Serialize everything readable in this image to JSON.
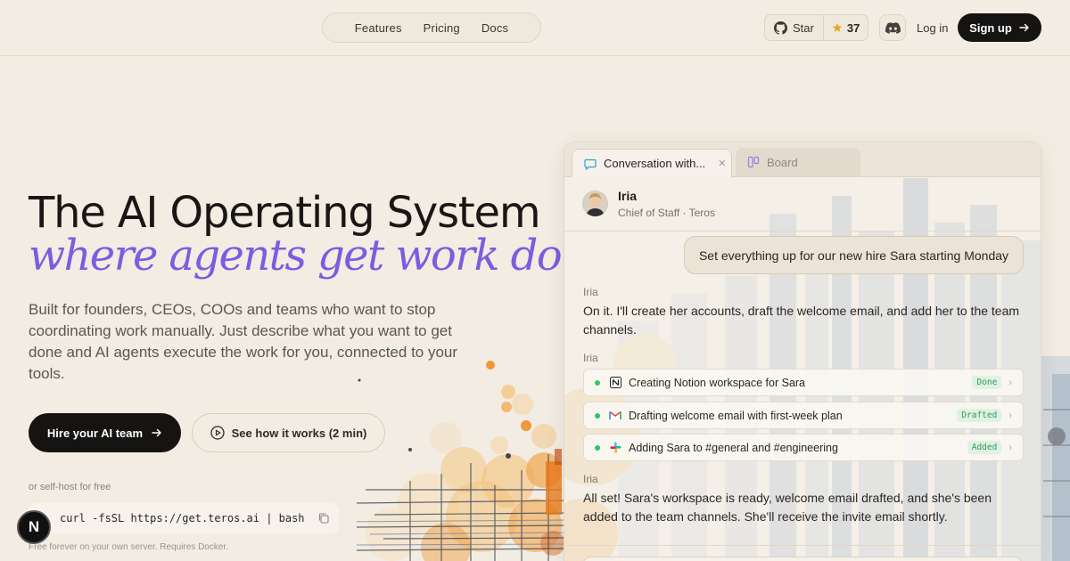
{
  "nav": {
    "links": [
      "Features",
      "Pricing",
      "Docs"
    ],
    "star_label": "Star",
    "star_count": "37",
    "login": "Log in",
    "signup": "Sign up"
  },
  "hero": {
    "title": "The AI Operating System",
    "subtitle": "where agents get work done.",
    "description": "Built for founders, CEOs, COOs and teams who want to stop coordinating work manually. Just describe what you want to get done and AI agents execute the work for you, connected to your tools.",
    "primary_cta": "Hire your AI team",
    "secondary_cta": "See how it works (2 min)",
    "selfhost_label": "or self-host for free",
    "install_command": "curl -fsSL https://get.teros.ai | bash",
    "install_note": "Free forever on your own server. Requires Docker.",
    "badge_letter": "N"
  },
  "panel": {
    "tabs": [
      {
        "label": "Conversation with...",
        "active": true
      },
      {
        "label": "Board",
        "active": false
      }
    ],
    "agent": {
      "name": "Iria",
      "role": "Chief of Staff · Teros"
    },
    "user_message": "Set everything up for our new hire Sara starting Monday",
    "messages": [
      {
        "sender": "Iria",
        "text": "On it. I'll create her accounts, draft the welcome email, and add her to the team channels."
      },
      {
        "sender": "Iria",
        "text": ""
      },
      {
        "sender": "Iria",
        "text": "All set! Sara's workspace is ready, welcome email drafted, and she's been added to the team channels. She'll receive the invite email shortly."
      }
    ],
    "tasks": [
      {
        "icon": "notion-icon",
        "label": "Creating Notion workspace for Sara",
        "status": "Done"
      },
      {
        "icon": "gmail-icon",
        "label": "Drafting welcome email with first-week plan",
        "status": "Drafted"
      },
      {
        "icon": "slack-icon",
        "label": "Adding Sara to #general and #engineering",
        "status": "Added"
      }
    ]
  },
  "colors": {
    "background": "#f3ece2",
    "accent_purple": "#7c5ce0",
    "dark_button": "#151413",
    "status_green": "#34c463"
  }
}
